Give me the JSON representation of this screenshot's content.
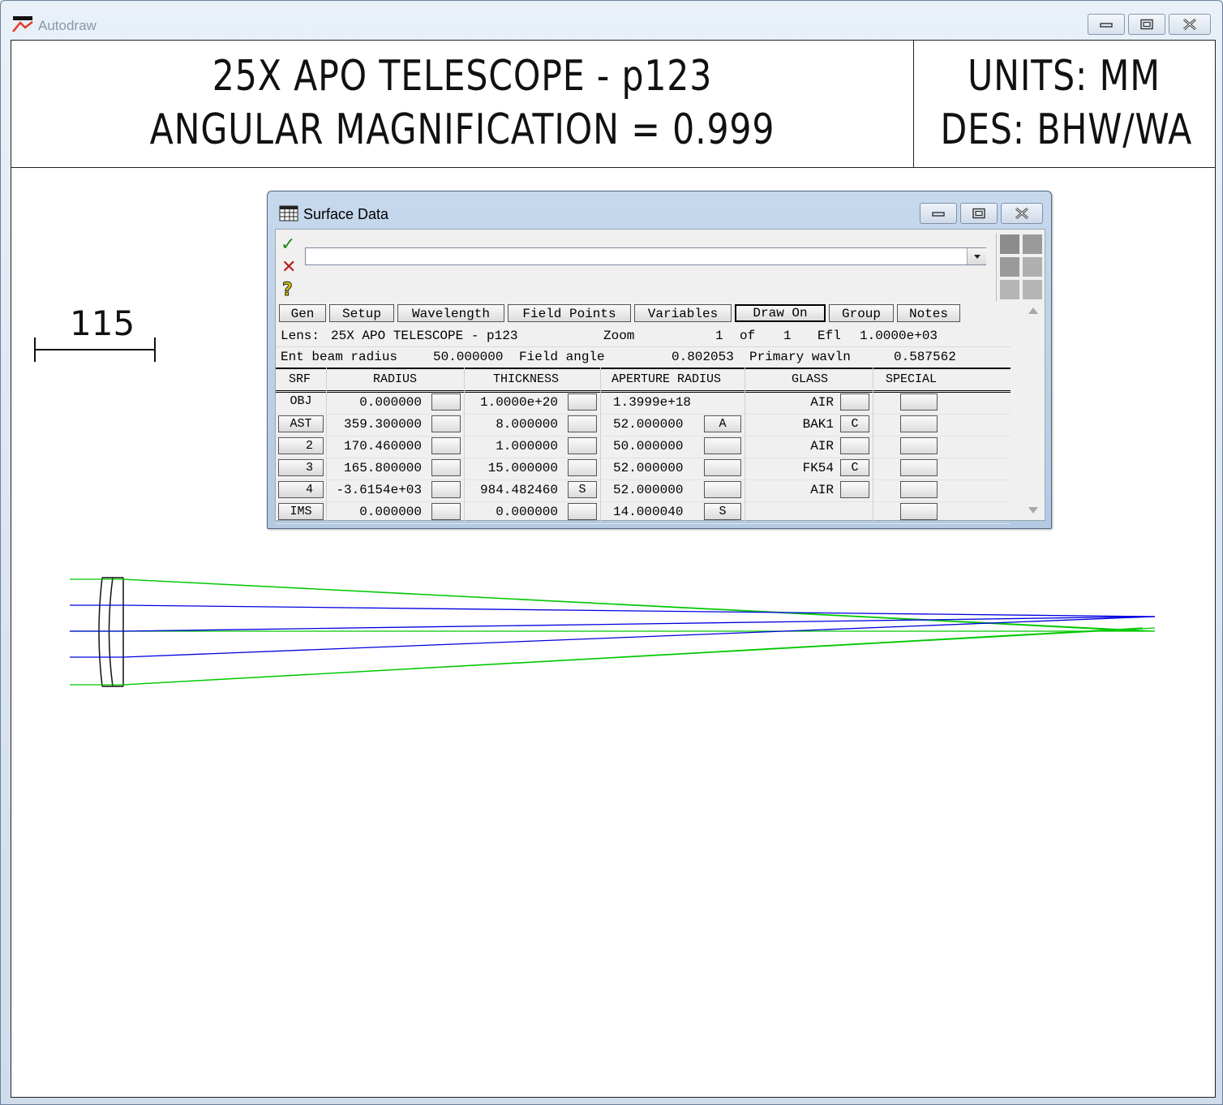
{
  "window": {
    "title": "Autodraw"
  },
  "drawing": {
    "title_line1": "25X APO TELESCOPE - p123",
    "title_line2": "ANGULAR MAGNIFICATION = 0.999",
    "units": "UNITS: MM",
    "designer": "DES: BHW/WA",
    "scale_label": "115",
    "ray_colors": {
      "green": "#00c800",
      "blue": "#0000e0"
    }
  },
  "dialog": {
    "title": "Surface Data",
    "command_value": "",
    "icons": [
      "check-icon",
      "cancel-icon",
      "help-icon"
    ],
    "tabs": [
      "Gen",
      "Setup",
      "Wavelength",
      "Field Points",
      "Variables",
      "Draw On",
      "Group",
      "Notes"
    ],
    "active_tab": "Draw On",
    "info": {
      "lens_label": "Lens:",
      "lens_name": "25X APO TELESCOPE - p123",
      "zoom_label": "Zoom",
      "zoom_value": "1",
      "of_label": "of",
      "zoom_total": "1",
      "efl_label": "Efl",
      "efl_value": "1.0000e+03",
      "ebr_label": "Ent beam radius",
      "ebr_value": "50.000000",
      "fa_label": "Field angle",
      "fa_value": "0.802053",
      "pw_label": "Primary wavln",
      "pw_value": "0.587562"
    },
    "columns": [
      "SRF",
      "RADIUS",
      "THICKNESS",
      "APERTURE RADIUS",
      "GLASS",
      "SPECIAL"
    ],
    "rows": [
      {
        "srf": "OBJ",
        "radius": "0.000000",
        "radius_flag": "",
        "thickness": "1.0000e+20",
        "thickness_flag": "",
        "aperture": "1.3999e+18",
        "aperture_flag": "",
        "glass": "AIR",
        "glass_flag": "",
        "special": ""
      },
      {
        "srf": "AST",
        "radius": "359.300000",
        "radius_flag": "",
        "thickness": "8.000000",
        "thickness_flag": "",
        "aperture": "52.000000",
        "aperture_flag": "A",
        "glass": "BAK1",
        "glass_flag": "C",
        "special": ""
      },
      {
        "srf": "2",
        "radius": "170.460000",
        "radius_flag": "",
        "thickness": "1.000000",
        "thickness_flag": "",
        "aperture": "50.000000",
        "aperture_flag": "",
        "glass": "AIR",
        "glass_flag": "",
        "special": ""
      },
      {
        "srf": "3",
        "radius": "165.800000",
        "radius_flag": "",
        "thickness": "15.000000",
        "thickness_flag": "",
        "aperture": "52.000000",
        "aperture_flag": "",
        "glass": "FK54",
        "glass_flag": "C",
        "special": ""
      },
      {
        "srf": "4",
        "radius": "-3.6154e+03",
        "radius_flag": "",
        "thickness": "984.482460",
        "thickness_flag": "S",
        "aperture": "52.000000",
        "aperture_flag": "",
        "glass": "AIR",
        "glass_flag": "",
        "special": ""
      },
      {
        "srf": "IMS",
        "radius": "0.000000",
        "radius_flag": "",
        "thickness": "0.000000",
        "thickness_flag": "",
        "aperture": "14.000040",
        "aperture_flag": "S",
        "glass": "",
        "glass_flag": "",
        "special": ""
      }
    ]
  }
}
